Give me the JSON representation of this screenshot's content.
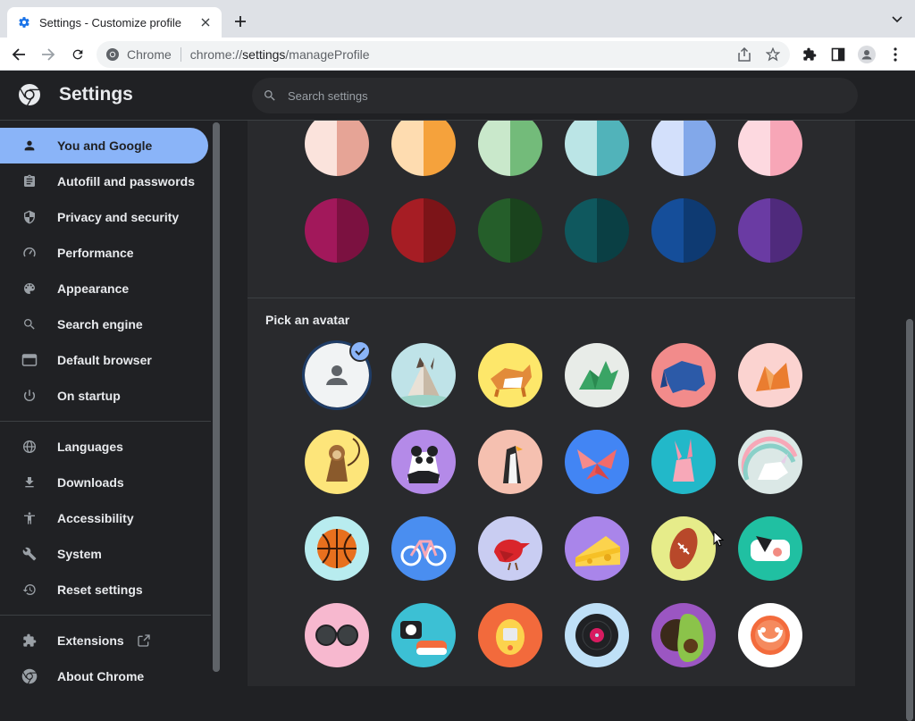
{
  "browser": {
    "tab_title": "Settings - Customize profile",
    "omnibox_scheme_label": "Chrome",
    "url_prefix": "chrome://",
    "url_host": "settings",
    "url_path": "/manageProfile"
  },
  "header": {
    "title": "Settings",
    "search_placeholder": "Search settings"
  },
  "sidebar": {
    "items": [
      {
        "label": "You and Google",
        "icon": "person-icon",
        "active": true
      },
      {
        "label": "Autofill and passwords",
        "icon": "clipboard-icon"
      },
      {
        "label": "Privacy and security",
        "icon": "shield-icon"
      },
      {
        "label": "Performance",
        "icon": "speedometer-icon"
      },
      {
        "label": "Appearance",
        "icon": "palette-icon"
      },
      {
        "label": "Search engine",
        "icon": "search-icon"
      },
      {
        "label": "Default browser",
        "icon": "browser-window-icon"
      },
      {
        "label": "On startup",
        "icon": "power-icon"
      },
      {
        "label": "Languages",
        "icon": "globe-icon"
      },
      {
        "label": "Downloads",
        "icon": "download-icon"
      },
      {
        "label": "Accessibility",
        "icon": "accessibility-icon"
      },
      {
        "label": "System",
        "icon": "wrench-icon"
      },
      {
        "label": "Reset settings",
        "icon": "history-icon"
      },
      {
        "label": "Extensions",
        "icon": "puzzle-icon"
      },
      {
        "label": "About Chrome",
        "icon": "chrome-icon"
      }
    ]
  },
  "theme_colors": {
    "row1": [
      {
        "left": "#fbe3dc",
        "right": "#e6a496"
      },
      {
        "left": "#fedcb0",
        "right": "#f5a23c"
      },
      {
        "left": "#c9e8cb",
        "right": "#73bb7a"
      },
      {
        "left": "#bbe5e6",
        "right": "#51b3ba"
      },
      {
        "left": "#d3e0fb",
        "right": "#82a8ea"
      },
      {
        "left": "#fdd9e0",
        "right": "#f7a6b7"
      }
    ],
    "row2": [
      {
        "left": "#a2185b",
        "right": "#7b1140"
      },
      {
        "left": "#a61d24",
        "right": "#7c1418"
      },
      {
        "left": "#255e2a",
        "right": "#1a431d"
      },
      {
        "left": "#0f585e",
        "right": "#0a3f44"
      },
      {
        "left": "#154e9a",
        "right": "#0e3a72"
      },
      {
        "left": "#6a3ba3",
        "right": "#4f2a7c"
      }
    ]
  },
  "avatar_section": {
    "label": "Pick an avatar",
    "selected_index": 0,
    "avatars": [
      {
        "name": "default-person-avatar",
        "bg": "#f1f3f4"
      },
      {
        "name": "origami-cat-avatar",
        "bg": "#bfe3e8"
      },
      {
        "name": "origami-corgi-avatar",
        "bg": "#fde76a"
      },
      {
        "name": "origami-dragon-avatar",
        "bg": "#e8ece8"
      },
      {
        "name": "origami-elephant-avatar",
        "bg": "#f28b8b"
      },
      {
        "name": "origami-fox-avatar",
        "bg": "#fbd3d0"
      },
      {
        "name": "origami-monkey-avatar",
        "bg": "#fde57a"
      },
      {
        "name": "origami-panda-avatar",
        "bg": "#b48ae8"
      },
      {
        "name": "origami-penguin-avatar",
        "bg": "#f5c0b0"
      },
      {
        "name": "origami-butterfly-avatar",
        "bg": "#4285f4"
      },
      {
        "name": "origami-rabbit-avatar",
        "bg": "#22b8c9"
      },
      {
        "name": "origami-unicorn-avatar",
        "bg": "#dbe8e6"
      },
      {
        "name": "basketball-avatar",
        "bg": "#b8ecef"
      },
      {
        "name": "bike-avatar",
        "bg": "#4a8ef0"
      },
      {
        "name": "red-bird-avatar",
        "bg": "#c9cdf2"
      },
      {
        "name": "cheese-avatar",
        "bg": "#a985ea"
      },
      {
        "name": "football-avatar",
        "bg": "#e6ec8a"
      },
      {
        "name": "burger-avatar",
        "bg": "#20c0a2"
      },
      {
        "name": "sunglasses-avatar",
        "bg": "#f7b8cf"
      },
      {
        "name": "sushi-avatar",
        "bg": "#3cc0d4"
      },
      {
        "name": "tamagotchi-avatar",
        "bg": "#f26a3c"
      },
      {
        "name": "vinyl-record-avatar",
        "bg": "#bfe0f7"
      },
      {
        "name": "avocado-avatar",
        "bg": "#9b56c2"
      },
      {
        "name": "smiley-avatar",
        "bg": "#ffffff"
      }
    ]
  },
  "colors": {
    "accent": "#8ab4f8",
    "surface": "#292a2d",
    "background": "#202124"
  }
}
